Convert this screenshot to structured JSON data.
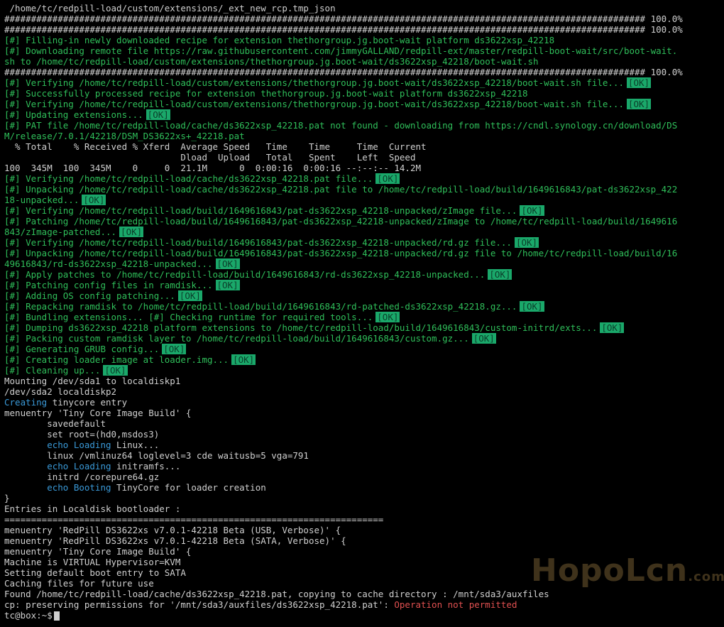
{
  "terminal": {
    "lines": [
      {
        "segs": [
          {
            "c": "w",
            "t": " /home/tc/redpill-load/custom/extensions/_ext_new_rcp.tmp_json"
          }
        ]
      },
      {
        "segs": [
          {
            "c": "w",
            "t": "######################################################################################################################## 100.0%"
          }
        ]
      },
      {
        "segs": [
          {
            "c": "w",
            "t": "######################################################################################################################## 100.0%"
          }
        ]
      },
      {
        "segs": [
          {
            "c": "g",
            "t": "[#] Filling-in newly downloaded recipe for extension thethorgroup.jg.boot-wait platform ds3622xsp_42218"
          }
        ]
      },
      {
        "segs": [
          {
            "c": "g",
            "t": "[#] Downloading remote file https://raw.githubusercontent.com/jimmyGALLAND/redpill-ext/master/redpill-boot-wait/src/boot-wait."
          }
        ]
      },
      {
        "segs": [
          {
            "c": "g",
            "t": "sh to /home/tc/redpill-load/custom/extensions/thethorgroup.jg.boot-wait/ds3622xsp_42218/boot-wait.sh"
          }
        ]
      },
      {
        "segs": [
          {
            "c": "w",
            "t": "######################################################################################################################## 100.0%"
          }
        ]
      },
      {
        "segs": [
          {
            "c": "g",
            "t": "[#] Verifying /home/tc/redpill-load/custom/extensions/thethorgroup.jg.boot-wait/ds3622xsp_42218/boot-wait.sh file..."
          },
          {
            "c": "ok",
            "t": "[OK]"
          }
        ]
      },
      {
        "segs": [
          {
            "c": "g",
            "t": "[#] Successfully processed recipe for extension thethorgroup.jg.boot-wait platform ds3622xsp_42218"
          }
        ]
      },
      {
        "segs": [
          {
            "c": "g",
            "t": "[#] Verifying /home/tc/redpill-load/custom/extensions/thethorgroup.jg.boot-wait/ds3622xsp_42218/boot-wait.sh file..."
          },
          {
            "c": "ok",
            "t": "[OK]"
          }
        ]
      },
      {
        "segs": [
          {
            "c": "g",
            "t": "[#] Updating extensions..."
          },
          {
            "c": "ok",
            "t": "[OK]"
          }
        ]
      },
      {
        "segs": [
          {
            "c": "g",
            "t": "[#] PAT file /home/tc/redpill-load/cache/ds3622xsp_42218.pat not found - downloading from https://cndl.synology.cn/download/DS"
          }
        ]
      },
      {
        "segs": [
          {
            "c": "g",
            "t": "M/release/7.0.1/42218/DSM_DS3622xs+_42218.pat"
          }
        ]
      },
      {
        "segs": [
          {
            "c": "w",
            "t": "  % Total    % Received % Xferd  Average Speed   Time    Time     Time  Current"
          }
        ]
      },
      {
        "segs": [
          {
            "c": "w",
            "t": "                                 Dload  Upload   Total   Spent    Left  Speed"
          }
        ]
      },
      {
        "segs": [
          {
            "c": "w",
            "t": "100  345M  100  345M    0     0  21.1M      0  0:00:16  0:00:16 --:--:-- 14.2M"
          }
        ]
      },
      {
        "segs": [
          {
            "c": "g",
            "t": "[#] Verifying /home/tc/redpill-load/cache/ds3622xsp_42218.pat file..."
          },
          {
            "c": "ok",
            "t": "[OK]"
          }
        ]
      },
      {
        "segs": [
          {
            "c": "g",
            "t": "[#] Unpacking /home/tc/redpill-load/cache/ds3622xsp_42218.pat file to /home/tc/redpill-load/build/1649616843/pat-ds3622xsp_422"
          }
        ]
      },
      {
        "segs": [
          {
            "c": "g",
            "t": "18-unpacked..."
          },
          {
            "c": "ok",
            "t": "[OK]"
          }
        ]
      },
      {
        "segs": [
          {
            "c": "g",
            "t": "[#] Verifying /home/tc/redpill-load/build/1649616843/pat-ds3622xsp_42218-unpacked/zImage file..."
          },
          {
            "c": "ok",
            "t": "[OK]"
          }
        ]
      },
      {
        "segs": [
          {
            "c": "g",
            "t": "[#] Patching /home/tc/redpill-load/build/1649616843/pat-ds3622xsp_42218-unpacked/zImage to /home/tc/redpill-load/build/1649616"
          }
        ]
      },
      {
        "segs": [
          {
            "c": "g",
            "t": "843/zImage-patched..."
          },
          {
            "c": "ok",
            "t": "[OK]"
          }
        ]
      },
      {
        "segs": [
          {
            "c": "g",
            "t": "[#] Verifying /home/tc/redpill-load/build/1649616843/pat-ds3622xsp_42218-unpacked/rd.gz file..."
          },
          {
            "c": "ok",
            "t": "[OK]"
          }
        ]
      },
      {
        "segs": [
          {
            "c": "g",
            "t": "[#] Unpacking /home/tc/redpill-load/build/1649616843/pat-ds3622xsp_42218-unpacked/rd.gz file to /home/tc/redpill-load/build/16"
          }
        ]
      },
      {
        "segs": [
          {
            "c": "g",
            "t": "49616843/rd-ds3622xsp_42218-unpacked..."
          },
          {
            "c": "ok",
            "t": "[OK]"
          }
        ]
      },
      {
        "segs": [
          {
            "c": "g",
            "t": "[#] Apply patches to /home/tc/redpill-load/build/1649616843/rd-ds3622xsp_42218-unpacked..."
          },
          {
            "c": "ok",
            "t": "[OK]"
          }
        ]
      },
      {
        "segs": [
          {
            "c": "g",
            "t": "[#] Patching config files in ramdisk..."
          },
          {
            "c": "ok",
            "t": "[OK]"
          }
        ]
      },
      {
        "segs": [
          {
            "c": "g",
            "t": "[#] Adding OS config patching..."
          },
          {
            "c": "ok",
            "t": "[OK]"
          }
        ]
      },
      {
        "segs": [
          {
            "c": "g",
            "t": "[#] Repacking ramdisk to /home/tc/redpill-load/build/1649616843/rd-patched-ds3622xsp_42218.gz..."
          },
          {
            "c": "ok",
            "t": "[OK]"
          }
        ]
      },
      {
        "segs": [
          {
            "c": "g",
            "t": "[#] Bundling extensions... [#] Checking runtime for required tools..."
          },
          {
            "c": "ok",
            "t": "[OK]"
          }
        ]
      },
      {
        "segs": [
          {
            "c": "g",
            "t": "[#] Dumping ds3622xsp_42218 platform extensions to /home/tc/redpill-load/build/1649616843/custom-initrd/exts..."
          },
          {
            "c": "ok",
            "t": "[OK]"
          }
        ]
      },
      {
        "segs": [
          {
            "c": "g",
            "t": "[#] Packing custom ramdisk layer to /home/tc/redpill-load/build/1649616843/custom.gz..."
          },
          {
            "c": "ok",
            "t": "[OK]"
          }
        ]
      },
      {
        "segs": [
          {
            "c": "g",
            "t": "[#] Generating GRUB config..."
          },
          {
            "c": "ok",
            "t": "[OK]"
          }
        ]
      },
      {
        "segs": [
          {
            "c": "g",
            "t": "[#] Creating loader image at loader.img..."
          },
          {
            "c": "ok",
            "t": "[OK]"
          }
        ]
      },
      {
        "segs": [
          {
            "c": "g",
            "t": "[#] Cleaning up..."
          },
          {
            "c": "ok",
            "t": "[OK]"
          }
        ]
      },
      {
        "segs": [
          {
            "c": "w",
            "t": "Mounting /dev/sda1 to localdiskp1"
          }
        ]
      },
      {
        "segs": [
          {
            "c": "w",
            "t": "/dev/sda2 localdiskp2"
          }
        ]
      },
      {
        "segs": [
          {
            "c": "b",
            "t": "Creating"
          },
          {
            "c": "w",
            "t": " tinycore entry"
          }
        ]
      },
      {
        "segs": [
          {
            "c": "w",
            "t": "menuentry 'Tiny Core Image Build' {"
          }
        ]
      },
      {
        "segs": [
          {
            "c": "w",
            "t": "        savedefault"
          }
        ]
      },
      {
        "segs": [
          {
            "c": "w",
            "t": "        set root=(hd0,msdos3)"
          }
        ]
      },
      {
        "segs": [
          {
            "c": "b",
            "t": "        echo Loading"
          },
          {
            "c": "w",
            "t": " Linux..."
          }
        ]
      },
      {
        "segs": [
          {
            "c": "w",
            "t": "        linux /vmlinuz64 loglevel=3 cde waitusb=5 vga=791"
          }
        ]
      },
      {
        "segs": [
          {
            "c": "b",
            "t": "        echo Loading"
          },
          {
            "c": "w",
            "t": " initramfs..."
          }
        ]
      },
      {
        "segs": [
          {
            "c": "w",
            "t": "        initrd /corepure64.gz"
          }
        ]
      },
      {
        "segs": [
          {
            "c": "b",
            "t": "        echo Booting"
          },
          {
            "c": "w",
            "t": " TinyCore for loader creation"
          }
        ]
      },
      {
        "segs": [
          {
            "c": "w",
            "t": "}"
          }
        ]
      },
      {
        "segs": [
          {
            "c": "w",
            "t": "Entries in Localdisk bootloader :"
          }
        ]
      },
      {
        "segs": [
          {
            "c": "w",
            "t": "======================================================================="
          }
        ]
      },
      {
        "segs": [
          {
            "c": "w",
            "t": "menuentry 'RedPill DS3622xs v7.0.1-42218 Beta (USB, Verbose)' {"
          }
        ]
      },
      {
        "segs": [
          {
            "c": "w",
            "t": "menuentry 'RedPill DS3622xs v7.0.1-42218 Beta (SATA, Verbose)' {"
          }
        ]
      },
      {
        "segs": [
          {
            "c": "w",
            "t": "menuentry 'Tiny Core Image Build' {"
          }
        ]
      },
      {
        "segs": [
          {
            "c": "w",
            "t": "Machine is VIRTUAL Hypervisor=KVM"
          }
        ]
      },
      {
        "segs": [
          {
            "c": "w",
            "t": "Setting default boot entry to SATA"
          }
        ]
      },
      {
        "segs": [
          {
            "c": "w",
            "t": "Caching files for future use"
          }
        ]
      },
      {
        "segs": [
          {
            "c": "w",
            "t": "Found /home/tc/redpill-load/cache/ds3622xsp_42218.pat, copying to cache directory : /mnt/sda3/auxfiles"
          }
        ]
      },
      {
        "segs": [
          {
            "c": "w",
            "t": "cp: preserving permissions for '/mnt/sda3/auxfiles/ds3622xsp_42218.pat': "
          },
          {
            "c": "r",
            "t": "Operation not permitted"
          }
        ]
      }
    ],
    "prompt": "tc@box:~$"
  },
  "watermark": {
    "main": "HopoLcn",
    "suffix": ".com"
  }
}
